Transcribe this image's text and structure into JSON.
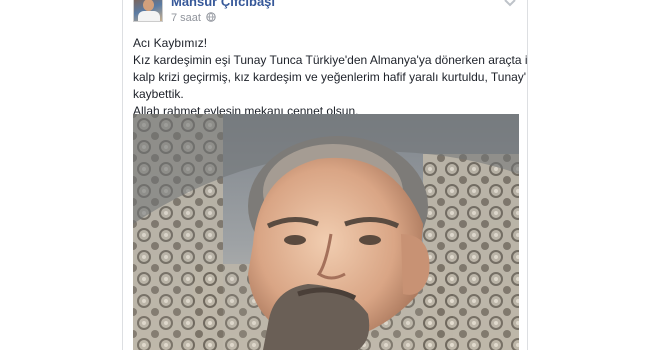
{
  "post": {
    "author": "Mansur Çifcibaşı",
    "time": "7 saat",
    "lines": [
      "Acı Kaybımız!",
      "Kız kardeşimin eşi Tunay Tunca Türkiye'den Almanya'ya dönerken araçta iken",
      "kalp krizi geçirmiş, kız kardeşim ve yeğenlerim hafif yaralı kurtuldu, Tunay'ı",
      "kaybettik.",
      "Allah rahmet eylesin mekanı cennet olsun."
    ],
    "icons": {
      "privacy": "globe-icon",
      "menu": "chevron-down-icon"
    }
  },
  "colors": {
    "author_link": "#365899",
    "meta_text": "#90949c",
    "body_text": "#1d2129",
    "border": "#dddfe2"
  }
}
